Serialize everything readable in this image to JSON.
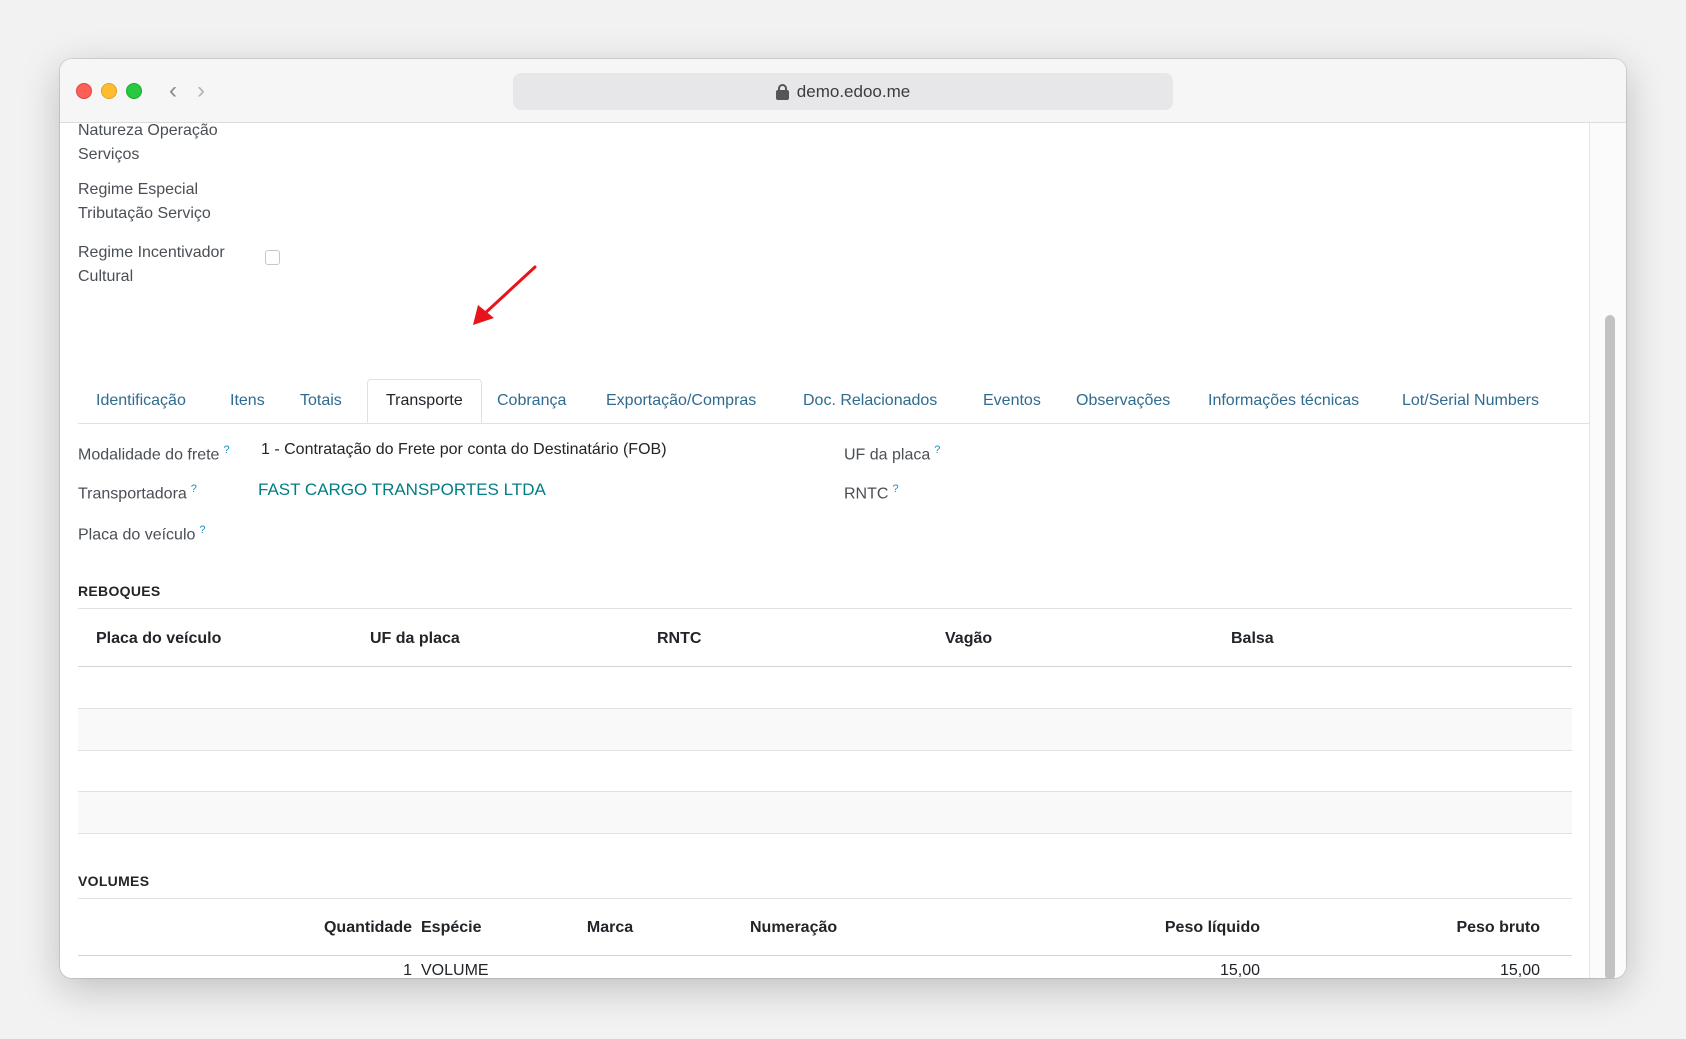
{
  "browser": {
    "url": "demo.edoo.me"
  },
  "fields_top": {
    "natureza_line1": "Natureza Operação",
    "natureza_line2": "Serviços",
    "regime_especial_line1": "Regime Especial",
    "regime_especial_line2": "Tributação Serviço",
    "regime_incentivador_line1": "Regime Incentivador",
    "regime_incentivador_line2": "Cultural"
  },
  "tabs": [
    {
      "label": "Identificação"
    },
    {
      "label": "Itens"
    },
    {
      "label": "Totais"
    },
    {
      "label": "Transporte",
      "active": true
    },
    {
      "label": "Cobrança"
    },
    {
      "label": "Exportação/Compras"
    },
    {
      "label": "Doc. Relacionados"
    },
    {
      "label": "Eventos"
    },
    {
      "label": "Observações"
    },
    {
      "label": "Informações técnicas"
    },
    {
      "label": "Lot/Serial Numbers"
    }
  ],
  "transporte": {
    "modalidade_label": "Modalidade do frete",
    "modalidade_value": "1 - Contratação do Frete por conta do Destinatário (FOB)",
    "transportadora_label": "Transportadora",
    "transportadora_value": "FAST CARGO TRANSPORTES LTDA",
    "placa_label": "Placa do veículo",
    "uf_placa_label": "UF da placa",
    "rntc_label": "RNTC",
    "help_mark": "?"
  },
  "reboques": {
    "title": "REBOQUES",
    "columns": [
      "Placa do veículo",
      "UF da placa",
      "RNTC",
      "Vagão",
      "Balsa"
    ]
  },
  "volumes": {
    "title": "VOLUMES",
    "columns": [
      "Quantidade",
      "Espécie",
      "Marca",
      "Numeração",
      "Peso líquido",
      "Peso bruto"
    ],
    "rows": [
      {
        "quantidade": "1",
        "especie": "VOLUME",
        "marca": "",
        "numeracao": "",
        "peso_liquido": "15,00",
        "peso_bruto": "15,00"
      }
    ]
  },
  "colors": {
    "link": "#017e84",
    "tab_link": "#2f6b8f",
    "arrow": "#e8141b"
  }
}
